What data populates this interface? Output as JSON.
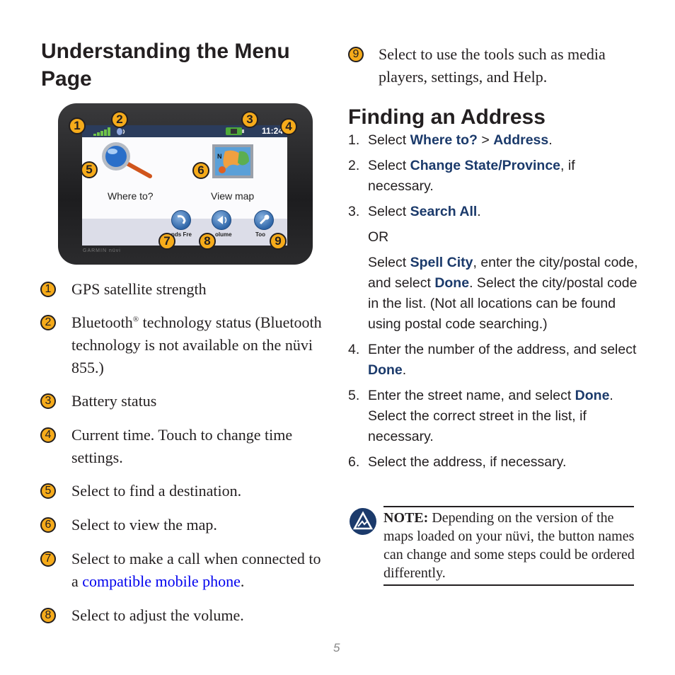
{
  "left": {
    "title": "Understanding the Menu Page",
    "device": {
      "time": "11:24",
      "brand_label": "GARMIN nüvi",
      "buttons": {
        "where_to": "Where to?",
        "view_map": "View map",
        "hands_free": "nds Fre",
        "volume": "olume",
        "tools": "Too"
      },
      "callouts": [
        "1",
        "2",
        "3",
        "4",
        "5",
        "6",
        "7",
        "8",
        "9"
      ]
    },
    "legend": [
      {
        "num": "1",
        "text": "GPS satellite strength"
      },
      {
        "num": "2",
        "text_pre": "Bluetooth",
        "sup": "®",
        "text_post": " technology status (Bluetooth technology is not available on the nüvi 855.)"
      },
      {
        "num": "3",
        "text": "Battery status"
      },
      {
        "num": "4",
        "text": "Current time. Touch to change time settings."
      },
      {
        "num": "5",
        "text": "Select to find a destination."
      },
      {
        "num": "6",
        "text": "Select to view the map."
      },
      {
        "num": "7",
        "text_pre": "Select to make a call when connected to a ",
        "link": "compatible mobile phone",
        "text_post": "."
      },
      {
        "num": "8",
        "text": "Select to adjust the volume."
      }
    ]
  },
  "right": {
    "legend9": {
      "num": "9",
      "text": "Select to use the tools such as media players, settings, and Help."
    },
    "title": "Finding an Address",
    "steps": {
      "s1": {
        "num": "1.",
        "pre": "Select ",
        "b1": "Where to?",
        "mid": " > ",
        "b2": "Address",
        "post": "."
      },
      "s2": {
        "num": "2.",
        "pre": "Select ",
        "b1": "Change State/Province",
        "post": ", if necessary."
      },
      "s3": {
        "num": "3.",
        "pre": "Select ",
        "b1": "Search All",
        "post": "."
      },
      "or": "OR",
      "s3b": {
        "pre": "Select ",
        "b1": "Spell City",
        "mid": ", enter the city/postal code, and select ",
        "b2": "Done",
        "post": ". Select the city/postal code in the list. (Not all locations can be found using postal code searching.)"
      },
      "s4": {
        "num": "4.",
        "pre": "Enter the number of the address, and select ",
        "b1": "Done",
        "post": "."
      },
      "s5": {
        "num": "5.",
        "pre": "Enter the street name, and select ",
        "b1": "Done",
        "post": ". Select the correct street in the list, if necessary."
      },
      "s6": {
        "num": "6.",
        "pre": "Select the address, if necessary."
      }
    },
    "note": {
      "label": "NOTE:",
      "text": " Depending on the version of the maps loaded on your nüvi, the button names can change and some steps could be ordered differently."
    }
  },
  "footer": {
    "page_number": "5"
  },
  "colors": {
    "callout": "#f6ab1a",
    "ui_term": "#1b3a6b",
    "link": "#0000ee"
  }
}
